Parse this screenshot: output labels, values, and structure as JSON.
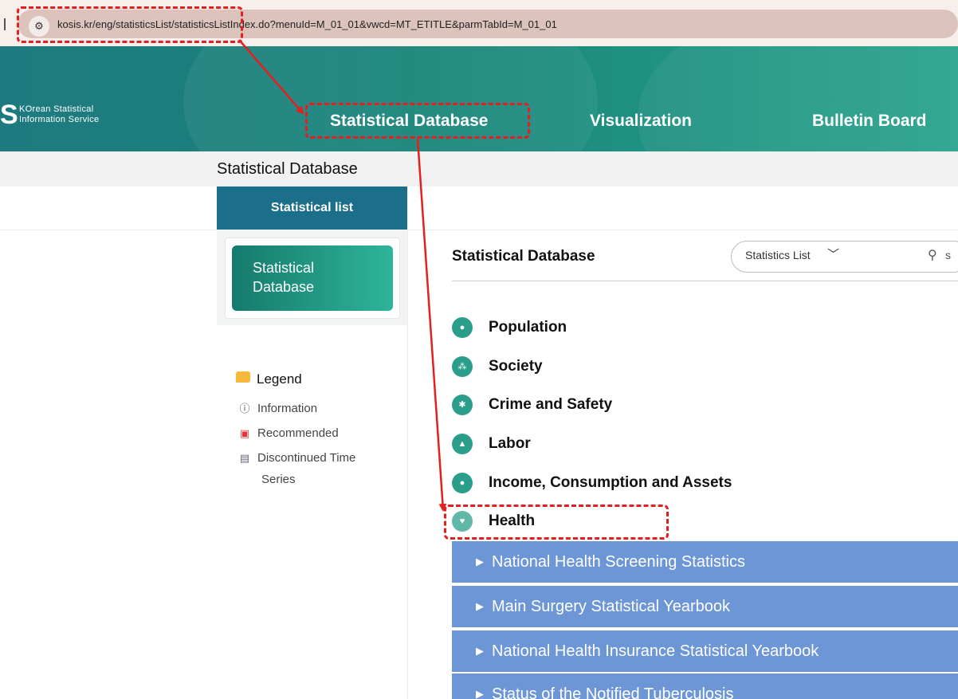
{
  "browser": {
    "site_icon": "site-settings-icon",
    "url": "kosis.kr/eng/statisticsList/statisticsListIndex.do?menuId=M_01_01&vwcd=MT_ETITLE&parmTabId=M_01_01"
  },
  "header": {
    "logo_line1": "KOrean Statistical",
    "logo_line2": "Information Service",
    "nav": [
      "Statistical Database",
      "Visualization",
      "Bulletin Board"
    ]
  },
  "page": {
    "title": "Statistical Database"
  },
  "sidebar": {
    "tab_label": "Statistical list",
    "button_line1": "Statistical",
    "button_line2": "Database",
    "legend": {
      "title": "Legend",
      "items": [
        "Information",
        "Recommended",
        "Discontinued Time",
        "Series"
      ]
    }
  },
  "content": {
    "title": "Statistical Database",
    "select_value": "Statistics List",
    "search_placeholder": "s",
    "categories": [
      "Population",
      "Society",
      "Crime and Safety",
      "Labor",
      "Income, Consumption and Assets",
      "Health"
    ],
    "health_items": [
      "National Health Screening Statistics",
      "Main Surgery Statistical Yearbook",
      "National Health Insurance Statistical Yearbook",
      "Status of the Notified Tuberculosis"
    ]
  },
  "colors": {
    "header_start": "#1f7a7f",
    "header_end": "#2aa48e",
    "tab_blue": "#1b6f8a",
    "category_green": "#2b9e8b",
    "subitem_blue": "#6d96d6",
    "annotation_red": "#e41f1f"
  }
}
